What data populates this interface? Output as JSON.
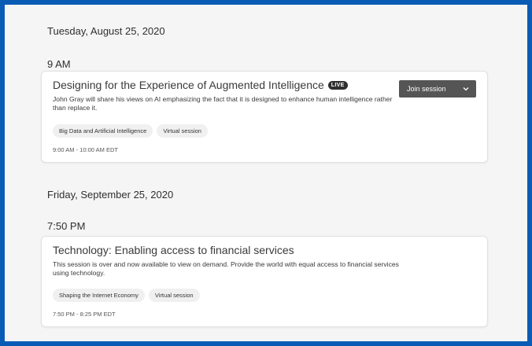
{
  "sessions": [
    {
      "date": "Tuesday, August 25, 2020",
      "time": "9 AM",
      "title": "Designing for the Experience of Augmented Intelligence",
      "live_badge": "LIVE",
      "description": "John Gray will share his views on AI emphasizing the fact that it is designed to enhance human intelligence rather than replace it.",
      "tags": [
        "Big Data and Artificial Intelligence",
        "Virtual session"
      ],
      "time_range": "9:00 AM - 10:00 AM EDT",
      "action_label": "Join session"
    },
    {
      "date": "Friday, September 25, 2020",
      "time": "7:50 PM",
      "title": "Technology: Enabling access to financial services",
      "description": "This session is over and now available to view on demand. Provide the world with equal access to financial services using technology.",
      "tags": [
        "Shaping the Internet Economy",
        "Virtual session"
      ],
      "time_range": "7:50 PM - 8:25 PM EDT"
    }
  ],
  "colors": {
    "frame_border": "#0a5bb5",
    "background": "#f5f5f5",
    "button": "#555555"
  },
  "icons": {
    "dropdown": "chevron-down-icon"
  }
}
